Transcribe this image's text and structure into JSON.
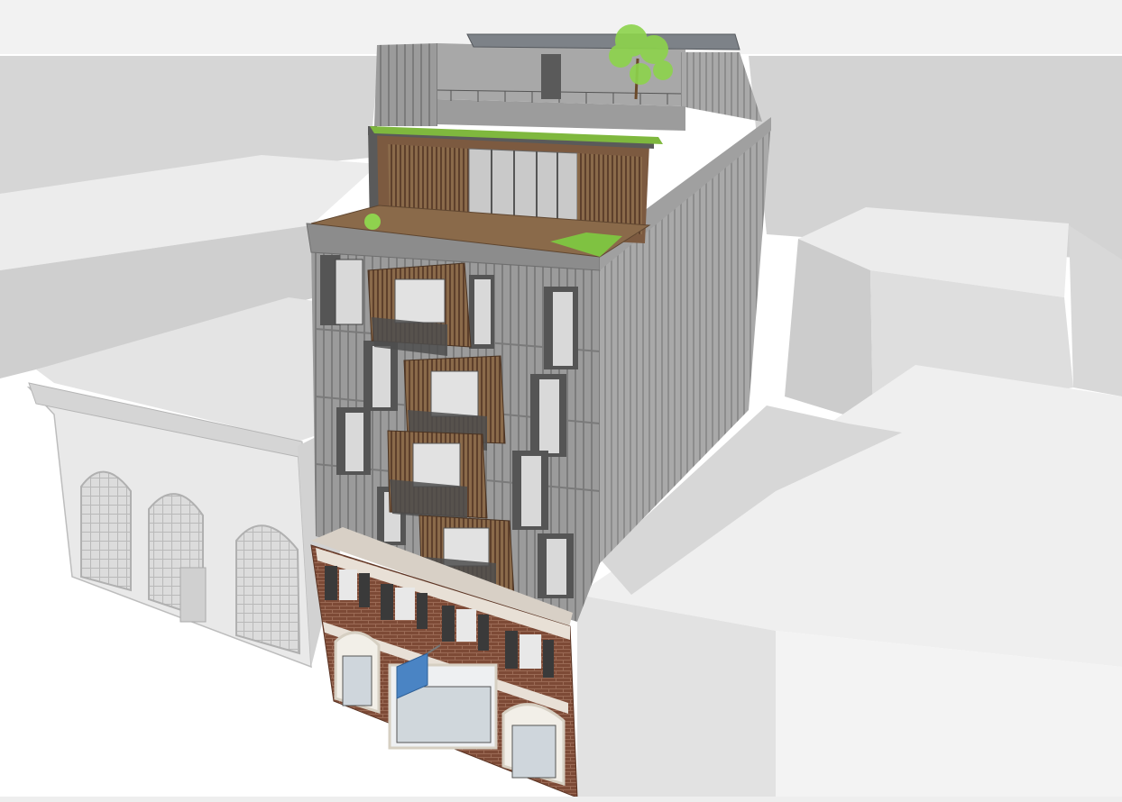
{
  "scene": {
    "description_visible_text": [],
    "palette": {
      "sky": "#f2f2f2",
      "ground": "#ffffff",
      "block_light": "#e8e8e8",
      "block_mid": "#d9d9d9",
      "block_dark": "#c9c9c9",
      "facade_gray": "#9a9a9a",
      "facade_dark": "#6f6f6f",
      "timber": "#6a4b35",
      "timber_light": "#8a6a4a",
      "brick": "#7d4a36",
      "greenery": "#7fc241",
      "glass": "#d8dfe4",
      "sign_blue": "#4a84c4"
    }
  }
}
